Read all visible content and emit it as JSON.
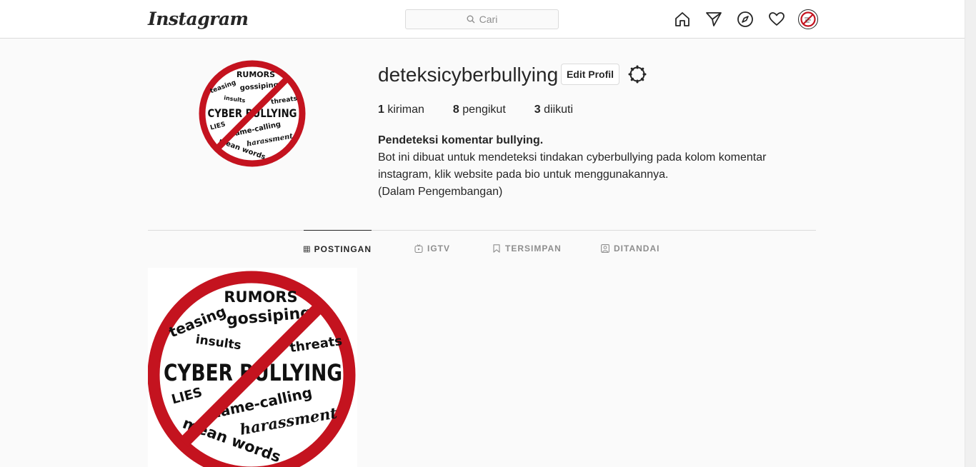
{
  "nav": {
    "logo": "Instagram",
    "search_placeholder": "Cari",
    "icons": [
      "home-icon",
      "direct-icon",
      "explore-icon",
      "activity-icon",
      "profile-avatar"
    ]
  },
  "profile": {
    "username": "deteksicyberbullying",
    "edit_label": "Edit Profil",
    "stats": [
      {
        "count": "1",
        "label": "kiriman"
      },
      {
        "count": "8",
        "label": "pengikut"
      },
      {
        "count": "3",
        "label": "diikuti"
      }
    ],
    "bio": {
      "name": "Pendeteksi komentar bullying.",
      "line1": "Bot ini dibuat untuk mendeteksi tindakan cyberbullying pada kolom komentar",
      "line2": "instagram, klik website pada bio untuk menggunakannya.",
      "line3": "(Dalam Pengembangan)"
    }
  },
  "tabs": [
    {
      "label": "POSTINGAN",
      "icon": "grid-icon",
      "active": true
    },
    {
      "label": "IGTV",
      "icon": "igtv-icon",
      "active": false
    },
    {
      "label": "TERSIMPAN",
      "icon": "bookmark-icon",
      "active": false
    },
    {
      "label": "DITANDAI",
      "icon": "tagged-icon",
      "active": false
    }
  ],
  "badge_words": {
    "main": "CYBER BULLYING",
    "words": [
      "RUMORS",
      "teasing",
      "gossiping",
      "insults",
      "threats",
      "LIES",
      "name-calling",
      "harassment",
      "mean words"
    ]
  },
  "colors": {
    "accent": "#262626",
    "border": "#dbdbdb",
    "muted": "#8e8e8e",
    "badge_red": "#c4131f"
  }
}
